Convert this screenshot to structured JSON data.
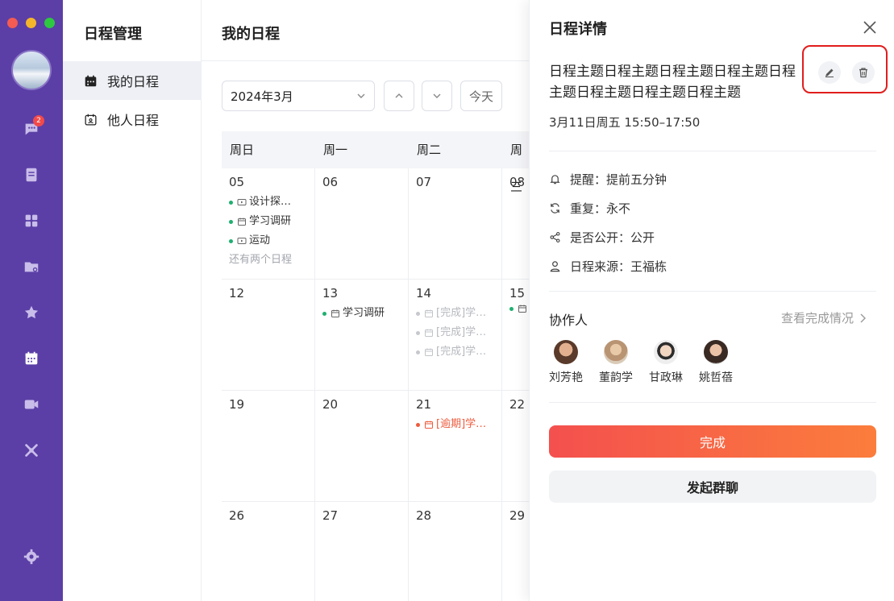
{
  "window": {
    "traffic_colors": [
      "#f45b52",
      "#f5b52a",
      "#2ec840"
    ]
  },
  "rail": {
    "icons": [
      "chat-icon",
      "notes-icon",
      "apps-icon",
      "folder-icon",
      "star-icon",
      "calendar-icon",
      "video-icon",
      "tools-icon",
      "settings-icon"
    ],
    "chat_badge": "2",
    "accent": "#5b3fa6"
  },
  "menu": {
    "title": "日程管理",
    "items": [
      {
        "label": "我的日程",
        "icon": "calendar-icon",
        "active": true
      },
      {
        "label": "他人日程",
        "icon": "person-calendar-icon",
        "active": false
      }
    ]
  },
  "main": {
    "title": "我的日程",
    "month_select": "2024年3月",
    "today_label": "今天",
    "weekdays": [
      "周日",
      "周一",
      "周二",
      "周三"
    ],
    "weeks": [
      [
        {
          "day": "05",
          "events": [
            {
              "text": "设计探…",
              "icon": "video-icon",
              "state": "normal"
            },
            {
              "text": "学习调研",
              "icon": "calendar-icon",
              "state": "normal"
            },
            {
              "text": "运动",
              "icon": "video-icon",
              "state": "normal"
            }
          ],
          "more": "还有两个日程"
        },
        {
          "day": "06",
          "events": []
        },
        {
          "day": "07",
          "events": []
        },
        {
          "day": "08",
          "events": []
        }
      ],
      [
        {
          "day": "12",
          "events": []
        },
        {
          "day": "13",
          "events": [
            {
              "text": "学习调研",
              "icon": "calendar-icon",
              "state": "normal"
            }
          ]
        },
        {
          "day": "14",
          "events": [
            {
              "text": "[完成]学…",
              "icon": "calendar-icon",
              "state": "done"
            },
            {
              "text": "[完成]学…",
              "icon": "calendar-icon",
              "state": "done"
            },
            {
              "text": "[完成]学…",
              "icon": "calendar-icon",
              "state": "done"
            }
          ]
        },
        {
          "day": "15",
          "events": [
            {
              "text": "",
              "icon": "calendar-icon",
              "state": "normal"
            }
          ]
        }
      ],
      [
        {
          "day": "19",
          "events": []
        },
        {
          "day": "20",
          "events": []
        },
        {
          "day": "21",
          "events": [
            {
              "text": "[逾期]学…",
              "icon": "calendar-icon",
              "state": "overdue"
            }
          ]
        },
        {
          "day": "22",
          "events": []
        }
      ],
      [
        {
          "day": "26",
          "events": []
        },
        {
          "day": "27",
          "events": []
        },
        {
          "day": "28",
          "events": []
        },
        {
          "day": "29",
          "events": []
        }
      ]
    ],
    "colors": {
      "dot_normal": "#1eb070",
      "dot_done": "#c6c8cd",
      "dot_overdue": "#ee5b3d"
    }
  },
  "panel": {
    "title": "日程详情",
    "subject": "日程主题日程主题日程主题日程主题日程主题日程主题日程主题日程主题",
    "time": "3月11日周五 15:50–17:50",
    "info": [
      {
        "icon": "bell-icon",
        "label": "提醒：",
        "value": "提前五分钟"
      },
      {
        "icon": "repeat-icon",
        "label": "重复：",
        "value": "永不"
      },
      {
        "icon": "share-icon",
        "label": "是否公开：",
        "value": "公开"
      },
      {
        "icon": "user-icon",
        "label": "日程来源：",
        "value": "王福栋"
      }
    ],
    "collaborators_title": "协作人",
    "collaborators_link": "查看完成情况",
    "members": [
      "刘芳艳",
      "董韵学",
      "甘政琳",
      "姚哲蓓"
    ],
    "done_button": "完成",
    "chat_button": "发起群聊"
  }
}
